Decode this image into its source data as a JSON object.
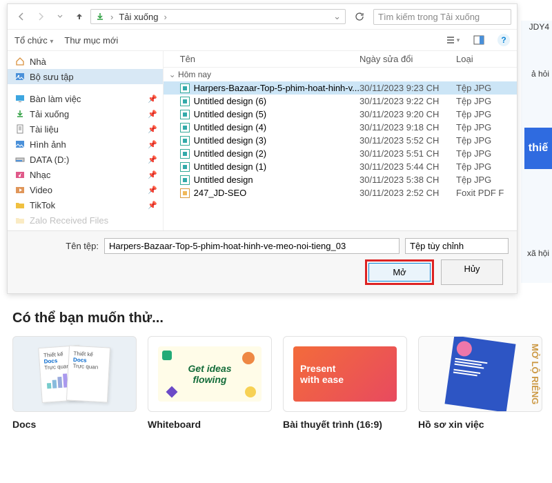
{
  "nav": {
    "path_label": "Tải xuống",
    "search_placeholder": "Tìm kiếm trong Tải xuống"
  },
  "toolbar": {
    "organize": "Tổ chức",
    "newfolder": "Thư mục mới"
  },
  "sidebar": {
    "home": "Nhà",
    "collection": "Bộ sưu tập",
    "desktop": "Bàn làm việc",
    "downloads": "Tải xuống",
    "documents": "Tài liệu",
    "pictures": "Hình ảnh",
    "data": "DATA (D:)",
    "music": "Nhạc",
    "video": "Video",
    "tiktok": "TikTok",
    "zalo": "Zalo Received Files"
  },
  "columns": {
    "name": "Tên",
    "date": "Ngày sửa đổi",
    "type": "Loại"
  },
  "group": "Hôm nay",
  "files": [
    {
      "name": "Harpers-Bazaar-Top-5-phim-hoat-hinh-v...",
      "date": "30/11/2023 9:23 CH",
      "type": "Tệp JPG",
      "selected": true
    },
    {
      "name": "Untitled design (6)",
      "date": "30/11/2023 9:22 CH",
      "type": "Tệp JPG"
    },
    {
      "name": "Untitled design (5)",
      "date": "30/11/2023 9:20 CH",
      "type": "Tệp JPG"
    },
    {
      "name": "Untitled design (4)",
      "date": "30/11/2023 9:18 CH",
      "type": "Tệp JPG"
    },
    {
      "name": "Untitled design (3)",
      "date": "30/11/2023 5:52 CH",
      "type": "Tệp JPG"
    },
    {
      "name": "Untitled design (2)",
      "date": "30/11/2023 5:51 CH",
      "type": "Tệp JPG"
    },
    {
      "name": "Untitled design (1)",
      "date": "30/11/2023 5:44 CH",
      "type": "Tệp JPG"
    },
    {
      "name": "Untitled design",
      "date": "30/11/2023 5:38 CH",
      "type": "Tệp JPG"
    },
    {
      "name": "247_JD-SEO",
      "date": "30/11/2023 2:52 CH",
      "type": "Foxit PDF F",
      "pdf": true
    }
  ],
  "footer": {
    "filename_label": "Tên tệp:",
    "filename_value": "Harpers-Bazaar-Top-5-phim-hoat-hinh-ve-meo-noi-tieng_03",
    "filter": "Tệp tùy chỉnh",
    "open": "Mở",
    "cancel": "Hủy"
  },
  "bg": {
    "tag1": "JDY4",
    "tag2": "ả hỏi",
    "blue": "thiế",
    "tag3": "xã hội"
  },
  "suggest": {
    "title": "Có thể bạn muốn thử...",
    "cards": [
      {
        "label": "Docs",
        "t1": "Thiết kế",
        "t2": "Docs",
        "t3": "Trực quan"
      },
      {
        "label": "Whiteboard",
        "t1": "Get ideas",
        "t2": "flowing"
      },
      {
        "label": "Bài thuyết trình (16:9)",
        "t1": "Present",
        "t2": "with ease"
      },
      {
        "label": "Hồ sơ xin việc",
        "t1": "MỞ LỘ",
        "t2": "RIÊNG"
      }
    ]
  }
}
